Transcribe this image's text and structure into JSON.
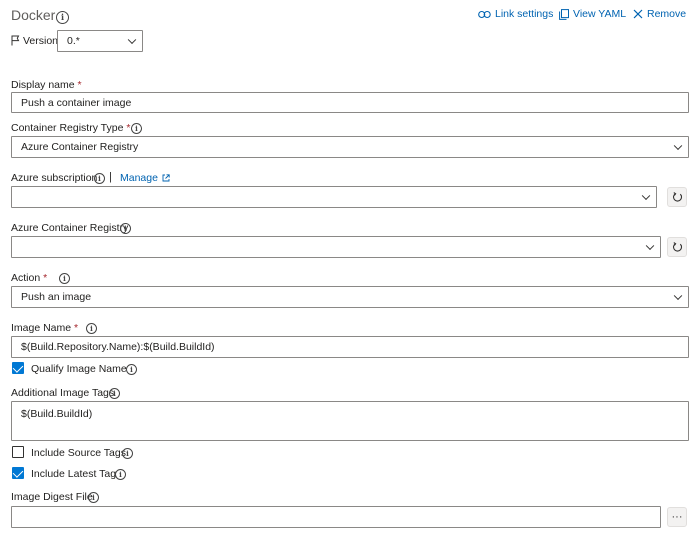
{
  "header": {
    "title": "Docker",
    "link_settings": "Link settings",
    "view_yaml": "View YAML",
    "remove": "Remove"
  },
  "version": {
    "label": "Version",
    "value": "0.*"
  },
  "fields": {
    "display_name": {
      "label": "Display name",
      "required": "*",
      "value": "Push a container image"
    },
    "registry_type": {
      "label": "Container Registry Type",
      "required": "*",
      "value": "Azure Container Registry"
    },
    "azure_subscription": {
      "label": "Azure subscription",
      "separator": "|",
      "manage": "Manage",
      "value": ""
    },
    "azure_registry": {
      "label": "Azure Container Registry",
      "value": ""
    },
    "action": {
      "label": "Action",
      "required": "*",
      "value": "Push an image"
    },
    "image_name": {
      "label": "Image Name",
      "required": "*",
      "value": "$(Build.Repository.Name):$(Build.BuildId)"
    },
    "qualify_image_name": {
      "label": "Qualify Image Name",
      "checked": true
    },
    "additional_tags": {
      "label": "Additional Image Tags",
      "value": "$(Build.BuildId)"
    },
    "include_source_tags": {
      "label": "Include Source Tags",
      "checked": false
    },
    "include_latest_tag": {
      "label": "Include Latest Tag",
      "checked": true
    },
    "image_digest_file": {
      "label": "Image Digest File",
      "value": "",
      "browse": "···"
    }
  },
  "colors": {
    "accent": "#0078d4",
    "link": "#0063b1",
    "required": "#a4262c"
  },
  "icons": [
    "info-icon",
    "link-icon",
    "yaml-icon",
    "close-icon",
    "flag-icon",
    "chevron-down-icon",
    "refresh-icon",
    "external-link-icon",
    "ellipsis-icon"
  ]
}
